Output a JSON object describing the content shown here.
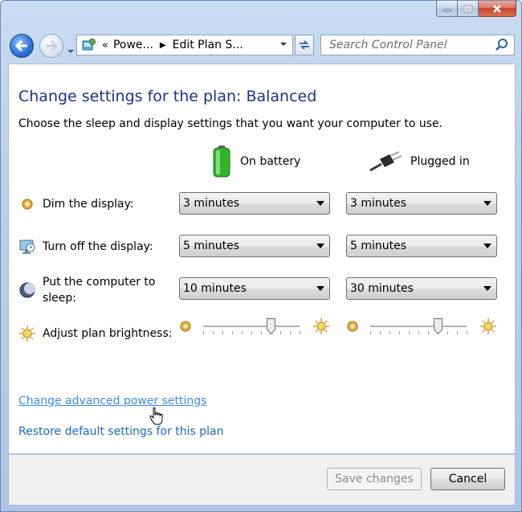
{
  "window": {
    "minimize_icon": "minimize-icon",
    "maximize_icon": "maximize-icon",
    "close_icon": "close-icon"
  },
  "nav": {
    "breadcrumb_prefix": "«",
    "crumbs": [
      "Powe...",
      "Edit Plan S..."
    ],
    "search_placeholder": "Search Control Panel"
  },
  "page": {
    "title": "Change settings for the plan: Balanced",
    "subtitle": "Choose the sleep and display settings that you want your computer to use."
  },
  "columns": {
    "battery": "On battery",
    "plugged": "Plugged in"
  },
  "rows": [
    {
      "label": "Dim the display:",
      "battery": "3 minutes",
      "plugged": "3 minutes"
    },
    {
      "label": "Turn off the display:",
      "battery": "5 minutes",
      "plugged": "5 minutes"
    },
    {
      "label_line1": "Put the computer to",
      "label_line2": "sleep:",
      "battery": "10 minutes",
      "plugged": "30 minutes"
    }
  ],
  "brightness": {
    "label": "Adjust plan brightness:",
    "battery_level_pct": 70,
    "plugged_level_pct": 70
  },
  "links": {
    "advanced": "Change advanced power settings",
    "restore": "Restore default settings for this plan"
  },
  "buttons": {
    "save": "Save changes",
    "cancel": "Cancel"
  },
  "colors": {
    "title": "#1e3287",
    "link": "#1e66c9"
  }
}
